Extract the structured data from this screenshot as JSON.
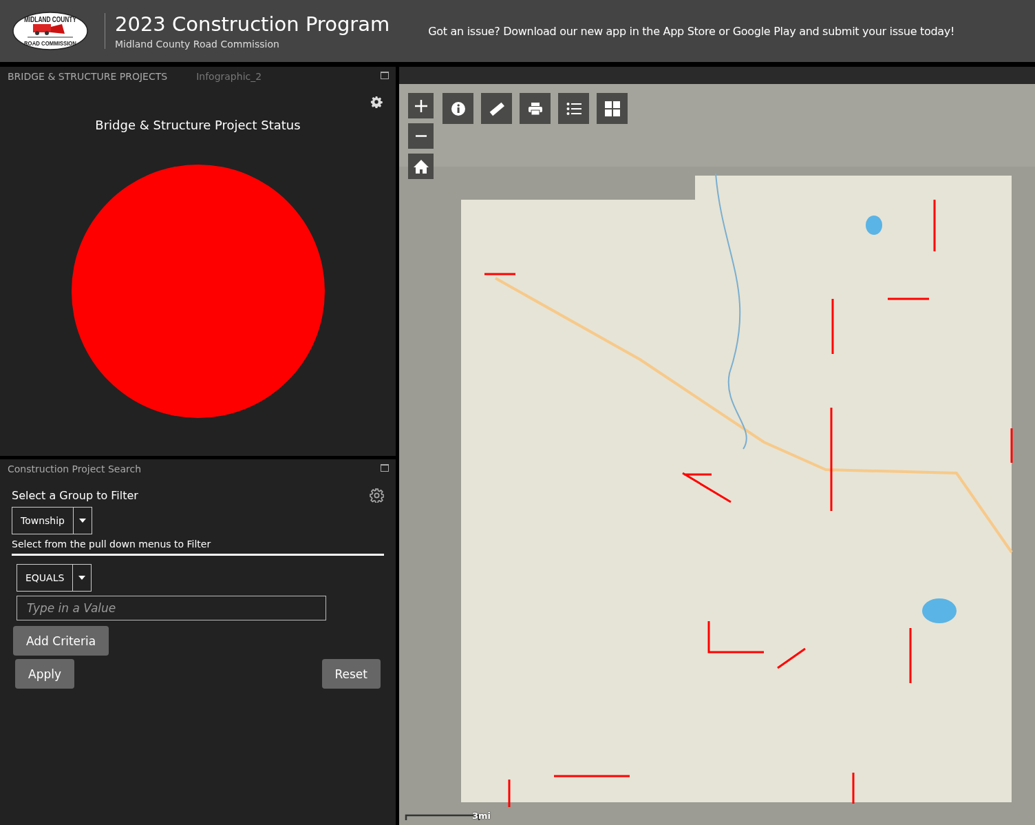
{
  "header": {
    "logo_top": "MIDLAND COUNTY",
    "logo_bottom": "ROAD COMMISSION",
    "title": "2023 Construction Program",
    "subtitle": "Midland County Road Commission",
    "notice": "Got an issue? Download our new app in the App Store or Google Play and submit your issue today!"
  },
  "infographic_panel": {
    "title": "BRIDGE & STRUCTURE PROJECTS",
    "tab": "Infographic_2",
    "chart_title": "Bridge & Structure Project Status"
  },
  "search_panel": {
    "title": "Construction Project Search",
    "group_label": "Select a Group to Filter",
    "group_value": "Township",
    "hint": "Select from the pull down menus to Filter",
    "operator_value": "EQUALS",
    "value_field": {
      "placeholder": "Type in a Value"
    },
    "buttons": [
      "Add Criteria",
      "Apply",
      "Reset"
    ]
  },
  "map": {
    "kind": "picture",
    "toolbar": [
      {
        "kind": "info"
      },
      {
        "kind": "measure"
      },
      {
        "kind": "print"
      },
      {
        "kind": "legend"
      },
      {
        "kind": "basemap"
      }
    ],
    "scale": "3mi"
  }
}
